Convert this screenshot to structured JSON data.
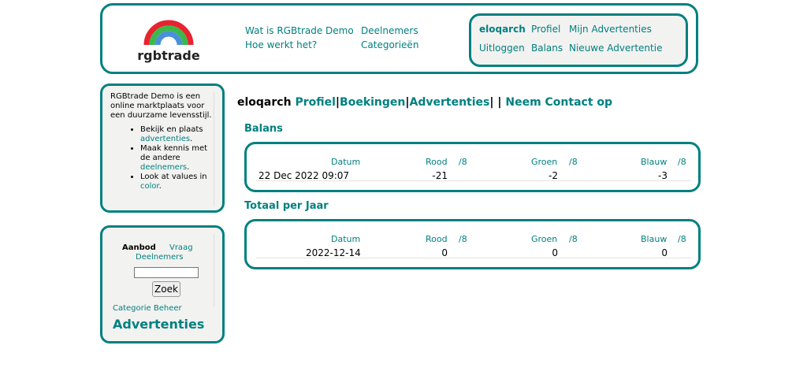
{
  "brand": {
    "name": "rgbtrade",
    "rainbow_colors": [
      "#e8232f",
      "#3cb84a",
      "#4a90d9"
    ]
  },
  "colors": {
    "accent": "#008080",
    "panel": "#f2f2f0"
  },
  "header": {
    "nav_col1": [
      "Wat is RGBtrade Demo",
      "Hoe werkt het?"
    ],
    "nav_col2": [
      "Deelnemers",
      "Categorieën"
    ],
    "user": {
      "username": "eloqarch",
      "profiel": "Profiel",
      "mijn_advertenties": "Mijn Advertenties",
      "uitloggen": "Uitloggen",
      "balans": "Balans",
      "nieuwe_advertentie": "Nieuwe Advertentie"
    }
  },
  "sidebar": {
    "info": {
      "intro": "RGBtrade Demo is een online marktplaats voor een duurzame levensstijl.",
      "item1_text": "Bekijk en plaats",
      "item1_link": "advertenties",
      "item2_text": "Maak kennis met de andere",
      "item2_link": "deelnemers",
      "item3_text": "Look at values in",
      "item3_link": "color",
      "period": "."
    },
    "search": {
      "tab_aanbod": "Aanbod",
      "tab_vraag": "Vraag",
      "tab_deelnemers": "Deelnemers",
      "input_value": "",
      "button": "Zoek",
      "categorie_beheer": "Categorie Beheer",
      "heading": "Advertenties"
    }
  },
  "main": {
    "title_user": "eloqarch",
    "title_links": [
      "Profiel",
      "Boekingen",
      "Advertenties"
    ],
    "title_contact": "Neem Contact op",
    "sep": "|",
    "balans": {
      "title": "Balans",
      "headers": {
        "datum": "Datum",
        "rood": "Rood",
        "groen": "Groen",
        "blauw": "Blauw",
        "div": "/8"
      },
      "row": {
        "datum": "22 Dec 2022 09:07",
        "rood": "-21",
        "groen": "-2",
        "blauw": "-3"
      }
    },
    "totaal": {
      "title": "Totaal per Jaar",
      "headers": {
        "datum": "Datum",
        "rood": "Rood",
        "groen": "Groen",
        "blauw": "Blauw",
        "div": "/8"
      },
      "row": {
        "datum": "2022-12-14",
        "rood": "0",
        "groen": "0",
        "blauw": "0"
      }
    }
  }
}
